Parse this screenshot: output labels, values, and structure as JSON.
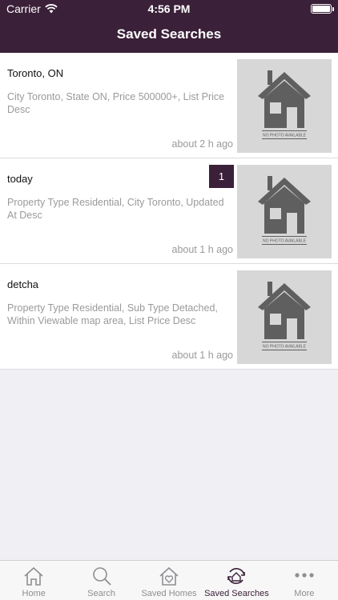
{
  "status_bar": {
    "carrier": "Carrier",
    "time": "4:56 PM"
  },
  "nav": {
    "title": "Saved Searches"
  },
  "thumb_caption": "NO PHOTO AVAILABLE",
  "searches": [
    {
      "title": "Toronto, ON",
      "description": "City Toronto, State ON, Price 500000+, List Price Desc",
      "time": "about 2 h ago",
      "badge": ""
    },
    {
      "title": "today",
      "description": "Property Type Residential, City Toronto, Updated At Desc",
      "time": "about 1 h ago",
      "badge": "1"
    },
    {
      "title": "detcha",
      "description": "Property Type Residential, Sub Type Detached, Within Viewable map area, List Price Desc",
      "time": "about 1 h ago",
      "badge": ""
    }
  ],
  "tabs": [
    {
      "label": "Home",
      "icon": "house-icon",
      "active": false
    },
    {
      "label": "Search",
      "icon": "magnifier-icon",
      "active": false
    },
    {
      "label": "Saved Homes",
      "icon": "heart-house-icon",
      "active": false
    },
    {
      "label": "Saved Searches",
      "icon": "refresh-house-icon",
      "active": true
    },
    {
      "label": "More",
      "icon": "dots-icon",
      "active": false
    }
  ],
  "colors": {
    "brand": "#3a2038",
    "inactive": "#8e8e93",
    "background": "#efeff4"
  }
}
